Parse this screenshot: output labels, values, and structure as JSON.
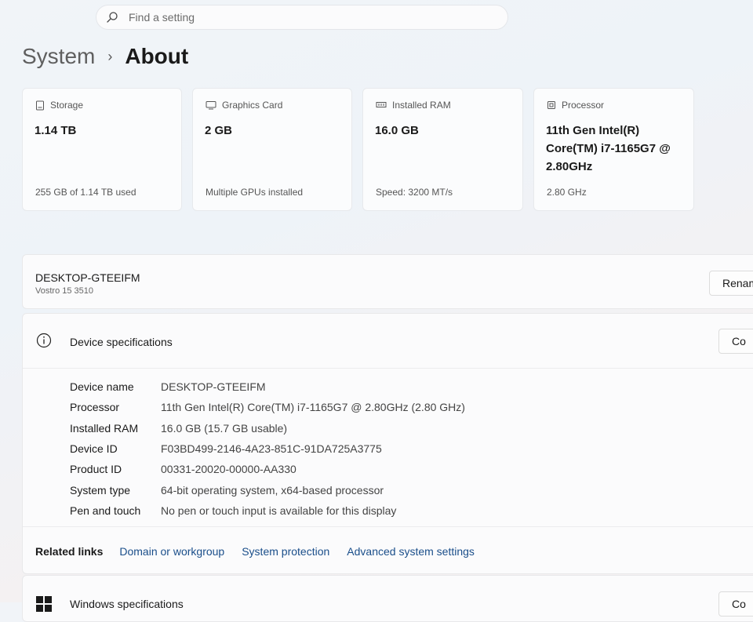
{
  "search": {
    "placeholder": "Find a setting"
  },
  "breadcrumb": {
    "parent": "System",
    "separator": "›",
    "current": "About"
  },
  "cards": [
    {
      "icon": "storage-icon",
      "label": "Storage",
      "value": "1.14 TB",
      "sub": "255 GB of 1.14 TB used"
    },
    {
      "icon": "graphics-card-icon",
      "label": "Graphics Card",
      "value": "2 GB",
      "sub": "Multiple GPUs installed"
    },
    {
      "icon": "ram-icon",
      "label": "Installed RAM",
      "value": "16.0 GB",
      "sub": "Speed: 3200 MT/s"
    },
    {
      "icon": "processor-icon",
      "label": "Processor",
      "value": "11th Gen Intel(R) Core(TM) i7-1165G7 @ 2.80GHz",
      "sub": "2.80 GHz"
    }
  ],
  "device": {
    "name": "DESKTOP-GTEEIFM",
    "model": "Vostro 15 3510",
    "rename_label": "Renam"
  },
  "specs": {
    "title": "Device specifications",
    "copy_label": "Co",
    "rows": [
      {
        "label": "Device name",
        "value": "DESKTOP-GTEEIFM"
      },
      {
        "label": "Processor",
        "value": "11th Gen Intel(R) Core(TM) i7-1165G7 @ 2.80GHz (2.80 GHz)"
      },
      {
        "label": "Installed RAM",
        "value": "16.0 GB (15.7 GB usable)"
      },
      {
        "label": "Device ID",
        "value": "F03BD499-2146-4A23-851C-91DA725A3775"
      },
      {
        "label": "Product ID",
        "value": "00331-20020-00000-AA330"
      },
      {
        "label": "System type",
        "value": "64-bit operating system, x64-based processor"
      },
      {
        "label": "Pen and touch",
        "value": "No pen or touch input is available for this display"
      }
    ]
  },
  "related": {
    "title": "Related links",
    "links": [
      "Domain or workgroup",
      "System protection",
      "Advanced system settings"
    ]
  },
  "windows_spec": {
    "title": "Windows specifications",
    "copy_label": "Co"
  },
  "colors": {
    "link": "#1a4e8a",
    "card_bg": "#fbfcfd"
  }
}
